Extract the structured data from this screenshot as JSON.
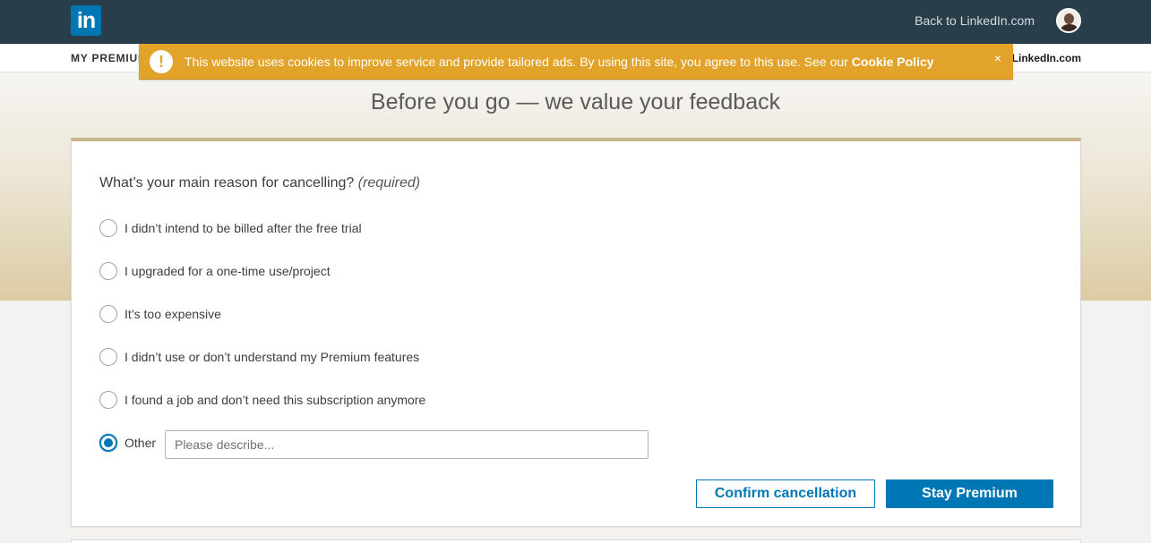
{
  "header": {
    "logo_text": "in",
    "back_link": "Back to LinkedIn.com"
  },
  "subnav": {
    "title": "MY PREMIUM",
    "right_link": "LinkedIn.com"
  },
  "cookie_banner": {
    "message": "This website uses cookies to improve service and provide tailored ads. By using this site, you agree to this use. See our ",
    "policy_link": "Cookie Policy",
    "close": "×",
    "warning_glyph": "!",
    "color": "#e2a32b"
  },
  "page": {
    "title": "Before you go — we value your feedback"
  },
  "form": {
    "question": "What’s your main reason for cancelling?",
    "required_note": "(required)",
    "options": [
      {
        "label": "I didn’t intend to be billed after the free trial",
        "checked": false
      },
      {
        "label": "I upgraded for a one-time use/project",
        "checked": false
      },
      {
        "label": "It’s too expensive",
        "checked": false
      },
      {
        "label": "I didn’t use or don’t understand my Premium features",
        "checked": false
      },
      {
        "label": "I found a job and don’t need this subscription anymore",
        "checked": false
      },
      {
        "label": "Other",
        "checked": true
      }
    ],
    "other_placeholder": "Please describe...",
    "other_value": "",
    "confirm_button": "Confirm cancellation",
    "stay_button": "Stay Premium",
    "accent_color": "#0077b5"
  }
}
